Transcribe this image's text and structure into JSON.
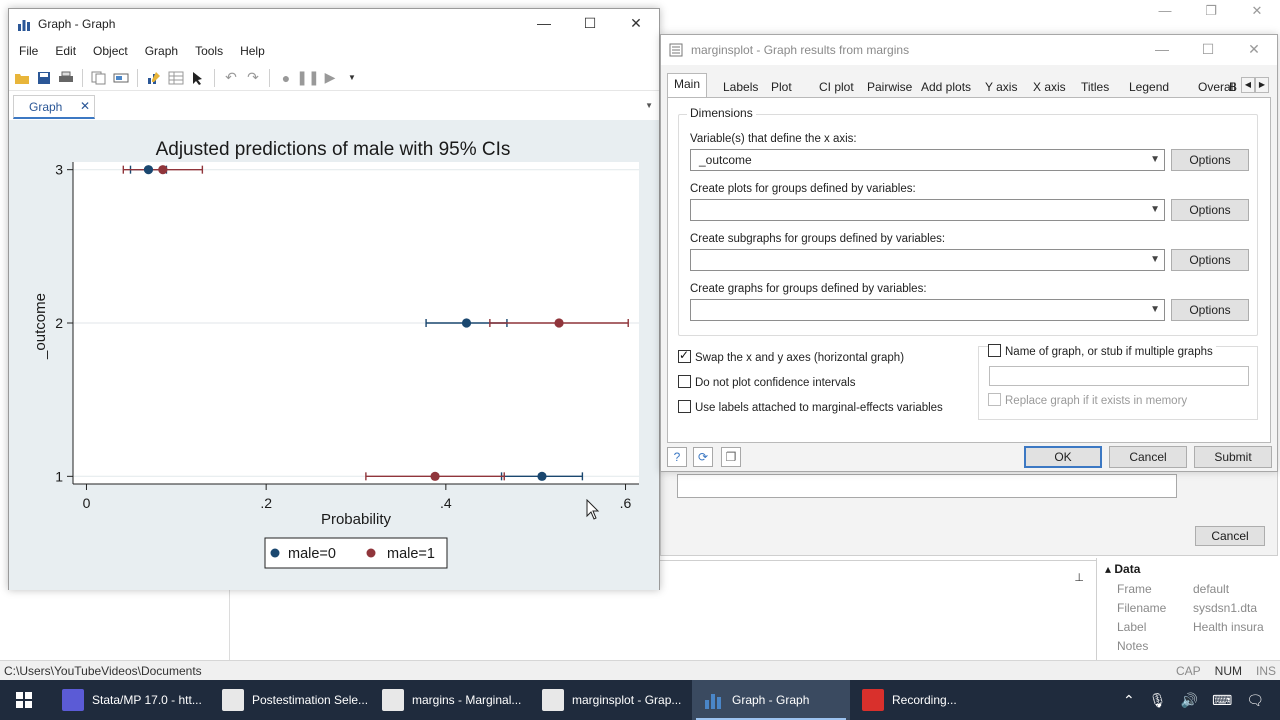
{
  "background_app": {
    "status_path": "C:\\Users\\YouTubeVideos\\Documents",
    "status_flags": [
      "CAP",
      "NUM",
      "INS"
    ],
    "cancel_label": "Cancel",
    "properties": {
      "section": "Data",
      "rows": [
        {
          "key": "Frame",
          "value": "default"
        },
        {
          "key": "Filename",
          "value": "sysdsn1.dta"
        },
        {
          "key": "Label",
          "value": "Health insura"
        },
        {
          "key": "Notes",
          "value": ""
        }
      ]
    }
  },
  "graph_window": {
    "title": "Graph - Graph",
    "menu": [
      "File",
      "Edit",
      "Object",
      "Graph",
      "Tools",
      "Help"
    ],
    "tab_label": "Graph",
    "toolbar_icons": [
      "open-icon",
      "save-icon",
      "print-icon",
      "copy-icon",
      "rename-icon",
      "graph-editor-icon",
      "data-editor-icon",
      "pointer-icon",
      "undo-icon",
      "redo-icon",
      "record-icon",
      "pause-icon",
      "play-icon"
    ]
  },
  "chart_data": {
    "type": "scatter",
    "title": "Adjusted predictions of male with 95% CIs",
    "xlabel": "Probability",
    "ylabel": "_outcome",
    "xlim": [
      -0.015,
      0.615
    ],
    "ylim": [
      0.95,
      3.05
    ],
    "xticks": [
      0,
      0.2,
      0.4,
      0.6
    ],
    "xtick_labels": [
      "0",
      ".2",
      ".4",
      ".6"
    ],
    "yticks": [
      1,
      2,
      3
    ],
    "ytick_labels": [
      "1",
      "2",
      "3"
    ],
    "grid": true,
    "orientation": "horizontal",
    "legend_position": "bottom",
    "series": [
      {
        "name": "male=0",
        "color": "#1a476f",
        "points": [
          {
            "y": 1,
            "x": 0.507,
            "lo": 0.462,
            "hi": 0.552
          },
          {
            "y": 2,
            "x": 0.423,
            "lo": 0.378,
            "hi": 0.468
          },
          {
            "y": 3,
            "x": 0.069,
            "lo": 0.049,
            "hi": 0.089
          }
        ]
      },
      {
        "name": "male=1",
        "color": "#90353b",
        "points": [
          {
            "y": 1,
            "x": 0.388,
            "lo": 0.311,
            "hi": 0.465
          },
          {
            "y": 2,
            "x": 0.526,
            "lo": 0.449,
            "hi": 0.603
          },
          {
            "y": 3,
            "x": 0.085,
            "lo": 0.041,
            "hi": 0.129
          }
        ]
      }
    ]
  },
  "dialog": {
    "title": "marginsplot - Graph results from margins",
    "tabs": [
      "Main",
      "Labels",
      "Plot",
      "CI plot",
      "Pairwise",
      "Add plots",
      "Y axis",
      "X axis",
      "Titles",
      "Legend",
      "Overall",
      "B"
    ],
    "active_tab": "Main",
    "group_title": "Dimensions",
    "fields": [
      {
        "label": "Variable(s) that define the x axis:",
        "value": "_outcome"
      },
      {
        "label": "Create plots for groups defined by variables:",
        "value": ""
      },
      {
        "label": "Create subgraphs for groups defined by variables:",
        "value": ""
      },
      {
        "label": "Create graphs for groups defined by variables:",
        "value": ""
      }
    ],
    "options_label": "Options",
    "checkboxes": [
      {
        "label": "Swap the x and y axes (horizontal graph)",
        "checked": true
      },
      {
        "label": "Do not plot confidence intervals",
        "checked": false
      },
      {
        "label": "Use labels attached to marginal-effects variables",
        "checked": false
      }
    ],
    "name_checkbox": "Name of graph, or stub if multiple graphs",
    "name_value": "",
    "replace_checkbox": "Replace graph if it exists in memory",
    "buttons": {
      "ok": "OK",
      "cancel": "Cancel",
      "submit": "Submit"
    }
  },
  "taskbar": {
    "items": [
      {
        "label": "Stata/MP 17.0 - htt...",
        "color": "#5b5bd6",
        "active": false
      },
      {
        "label": "Postestimation Sele...",
        "color": "#e8e8e8",
        "active": false
      },
      {
        "label": "margins - Marginal...",
        "color": "#e8e8e8",
        "active": false
      },
      {
        "label": "marginsplot - Grap...",
        "color": "#e8e8e8",
        "active": false
      },
      {
        "label": "Graph - Graph",
        "color": "#4a86c8",
        "active": true
      },
      {
        "label": "Recording...",
        "color": "#d9302c",
        "active": false
      }
    ]
  }
}
